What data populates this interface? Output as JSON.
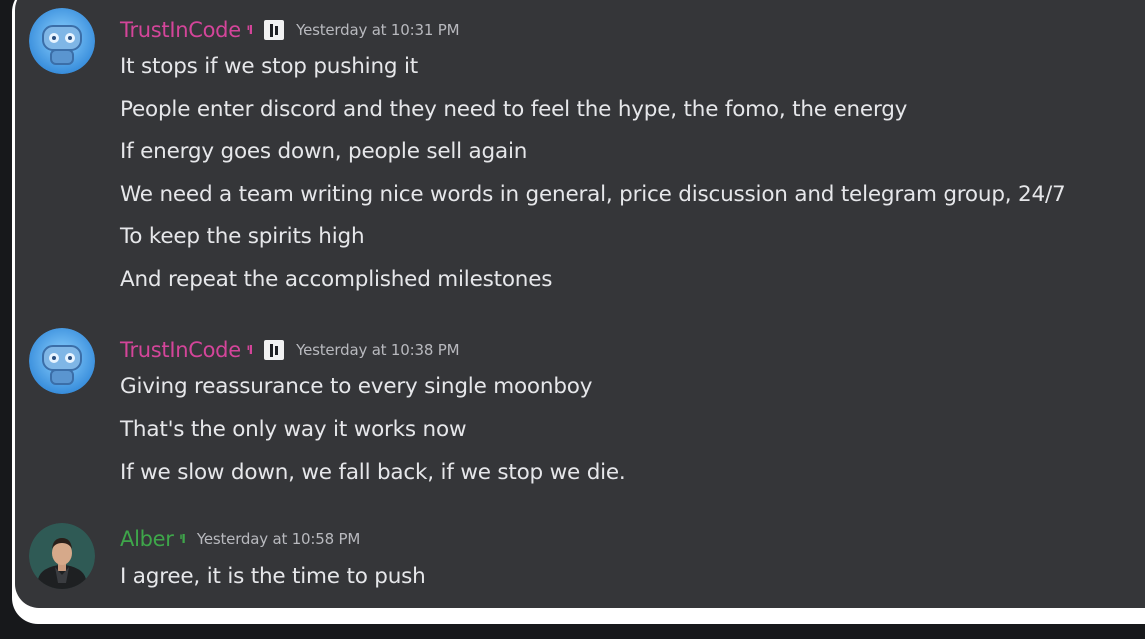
{
  "messages": [
    {
      "author": "TrustInCode",
      "author_color": "#d4459a",
      "role_icon": "ᴵI",
      "badge_icon": "pause-bars-badge",
      "timestamp": "Yesterday at 10:31 PM",
      "lines": [
        "It stops if we stop pushing it",
        "People enter discord and they need to feel the hype, the fomo, the energy",
        "If energy goes down, people sell again",
        "We need a team writing nice words in general, price discussion and telegram group, 24/7",
        "To keep the spirits high",
        "And repeat the accomplished milestones"
      ]
    },
    {
      "author": "TrustInCode",
      "author_color": "#d4459a",
      "role_icon": "ᴵI",
      "badge_icon": "pause-bars-badge",
      "timestamp": "Yesterday at 10:38 PM",
      "lines": [
        "Giving reassurance to every single moonboy",
        "That's the only way it works now",
        "If we slow down, we fall back, if we stop we die."
      ]
    },
    {
      "author": "Alber",
      "author_color": "#3ea64a",
      "role_icon": "ᴵI",
      "timestamp": "Yesterday at 10:58 PM",
      "lines": [
        "I agree, it is the time to push"
      ]
    }
  ]
}
